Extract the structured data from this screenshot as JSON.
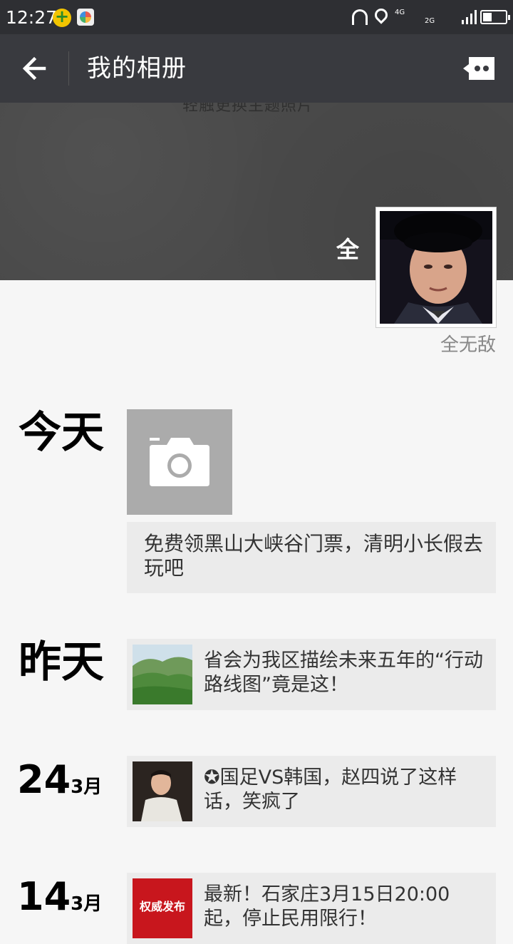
{
  "status_bar": {
    "time": "12:27",
    "network_top": "4G",
    "network_bottom": "2G"
  },
  "app_bar": {
    "title": "我的相册"
  },
  "cover": {
    "hint": "轻触更换主题照片",
    "username": "全",
    "signature": "全无敌"
  },
  "timeline": [
    {
      "date_label": "今天",
      "camera_icon": "camera-icon",
      "card": {
        "title": "免费领黑山大峡谷门票，清明小长假去玩吧"
      }
    },
    {
      "date_label": "昨天",
      "card": {
        "title": "省会为我区描绘未来五年的“行动路线图”竟是这！"
      }
    },
    {
      "day": "24",
      "month": "3月",
      "card": {
        "title": "✪国足VS韩国，赵四说了这样话，笑疯了"
      }
    },
    {
      "day": "14",
      "month": "3月",
      "card": {
        "title": "最新！石家庄3月15日20:00起，停止民用限行！",
        "thumb_text": "权威发布"
      }
    }
  ],
  "colors": {
    "status_bar": "#2e2f33",
    "app_bar": "#393a3f",
    "page_bg": "#f6f6f6",
    "card_bg": "#ebebeb",
    "camera_bg": "#ababab"
  }
}
